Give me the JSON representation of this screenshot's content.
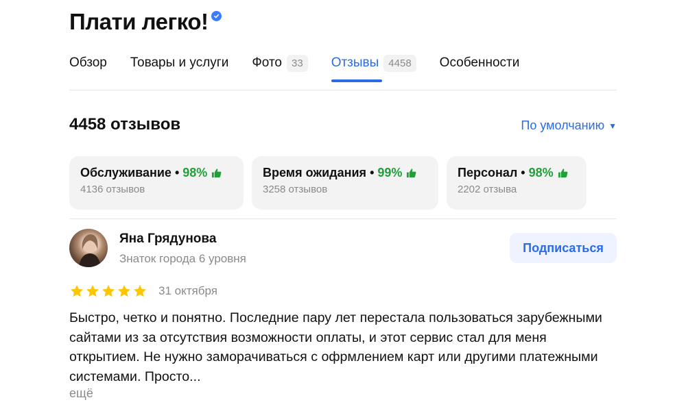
{
  "header": {
    "title": "Плати легко!",
    "verified_icon": "verified-checkmark-icon",
    "verified_color": "#3a7bff"
  },
  "tabs": [
    {
      "label": "Обзор",
      "count": null,
      "active": false
    },
    {
      "label": "Товары и услуги",
      "count": null,
      "active": false
    },
    {
      "label": "Фото",
      "count": "33",
      "active": false
    },
    {
      "label": "Отзывы",
      "count": "4458",
      "active": true
    },
    {
      "label": "Особенности",
      "count": null,
      "active": false
    }
  ],
  "reviews_section": {
    "title": "4458 отзывов",
    "sort_label": "По умолчанию",
    "sort_icon": "dropdown-triangle-icon",
    "accent_color": "#2b6be6"
  },
  "aspects": [
    {
      "name": "Обслуживание",
      "percent": "98%",
      "count_label": "4136 отзывов"
    },
    {
      "name": "Время ожидания",
      "percent": "99%",
      "count_label": "3258 отзывов"
    },
    {
      "name": "Персонал",
      "percent": "98%",
      "count_label": "2202 отзыва"
    }
  ],
  "aspect_separator": "•",
  "aspect_icon": "thumbs-up-icon",
  "positive_color": "#21a038",
  "review": {
    "author": "Яна Грядунова",
    "level": "Знаток города 6 уровня",
    "subscribe_label": "Подписаться",
    "rating": 5,
    "date": "31 октября",
    "text": "Быстро, четко и понятно. Последние пару лет перестала пользоваться зарубежными сайтами из за отсутствия возможности оплаты, и этот сервис стал для меня открытием. Не нужно заморачиваться с офрмлением карт или другими платежными системами. Просто...",
    "more_label": "ещё",
    "star_color": "#fcc600"
  }
}
